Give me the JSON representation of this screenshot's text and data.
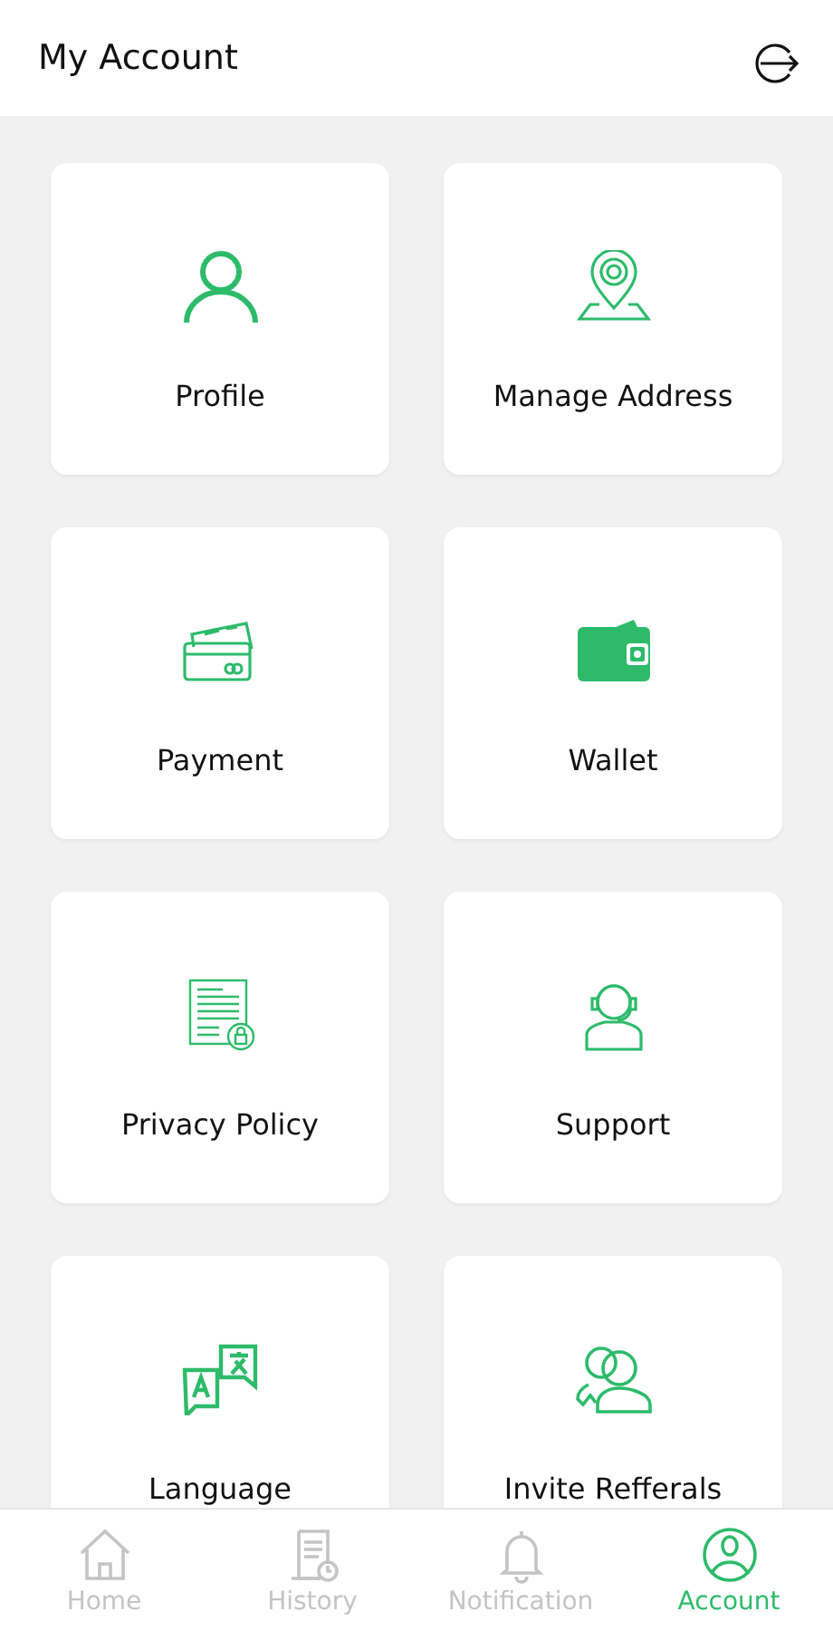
{
  "header": {
    "title": "My Account"
  },
  "tiles": [
    {
      "kind": "profile",
      "label": "Profile"
    },
    {
      "kind": "address",
      "label": "Manage Address"
    },
    {
      "kind": "payment",
      "label": "Payment"
    },
    {
      "kind": "wallet",
      "label": "Wallet"
    },
    {
      "kind": "privacy",
      "label": "Privacy Policy"
    },
    {
      "kind": "support",
      "label": "Support"
    },
    {
      "kind": "language",
      "label": "Language"
    },
    {
      "kind": "referral",
      "label": "Invite Refferals"
    }
  ],
  "nav": [
    {
      "kind": "home",
      "label": "Home",
      "selected": false
    },
    {
      "kind": "history",
      "label": "History",
      "selected": false
    },
    {
      "kind": "notification",
      "label": "Notification",
      "selected": false
    },
    {
      "kind": "account",
      "label": "Account",
      "selected": true
    }
  ]
}
